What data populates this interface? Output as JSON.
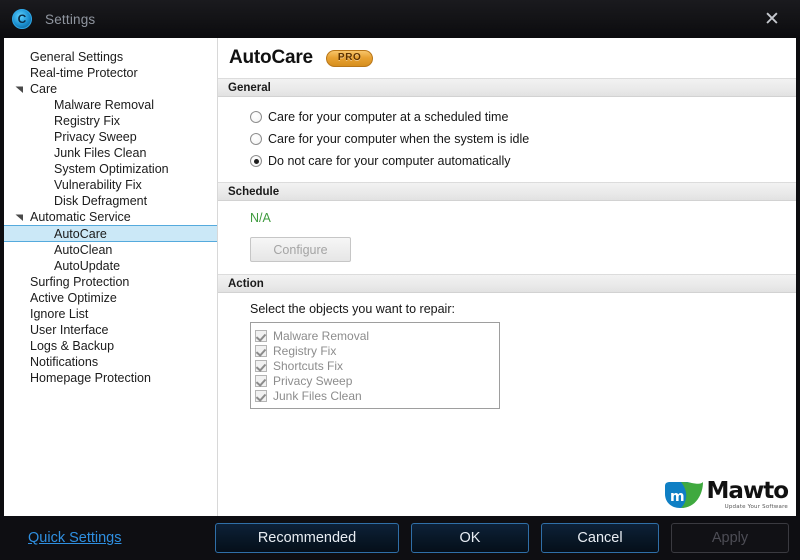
{
  "window": {
    "title": "Settings",
    "logo_icon": "copyright-circle-icon",
    "close_icon": "close-icon"
  },
  "sidebar": {
    "items": [
      {
        "label": "General Settings",
        "level": 1,
        "expander": "none",
        "selected": false
      },
      {
        "label": "Real-time Protector",
        "level": 1,
        "expander": "none",
        "selected": false
      },
      {
        "label": "Care",
        "level": 1,
        "expander": "expanded",
        "selected": false
      },
      {
        "label": "Malware Removal",
        "level": 2,
        "expander": "none",
        "selected": false
      },
      {
        "label": "Registry Fix",
        "level": 2,
        "expander": "none",
        "selected": false
      },
      {
        "label": "Privacy Sweep",
        "level": 2,
        "expander": "none",
        "selected": false
      },
      {
        "label": "Junk Files Clean",
        "level": 2,
        "expander": "none",
        "selected": false
      },
      {
        "label": "System Optimization",
        "level": 2,
        "expander": "none",
        "selected": false
      },
      {
        "label": "Vulnerability Fix",
        "level": 2,
        "expander": "none",
        "selected": false
      },
      {
        "label": "Disk Defragment",
        "level": 2,
        "expander": "none",
        "selected": false
      },
      {
        "label": "Automatic Service",
        "level": 1,
        "expander": "expanded",
        "selected": false
      },
      {
        "label": "AutoCare",
        "level": 2,
        "expander": "none",
        "selected": true
      },
      {
        "label": "AutoClean",
        "level": 2,
        "expander": "none",
        "selected": false
      },
      {
        "label": "AutoUpdate",
        "level": 2,
        "expander": "none",
        "selected": false
      },
      {
        "label": "Surfing Protection",
        "level": 1,
        "expander": "none",
        "selected": false
      },
      {
        "label": "Active Optimize",
        "level": 1,
        "expander": "none",
        "selected": false
      },
      {
        "label": "Ignore List",
        "level": 1,
        "expander": "none",
        "selected": false
      },
      {
        "label": "User Interface",
        "level": 1,
        "expander": "none",
        "selected": false
      },
      {
        "label": "Logs & Backup",
        "level": 1,
        "expander": "none",
        "selected": false
      },
      {
        "label": "Notifications",
        "level": 1,
        "expander": "none",
        "selected": false
      },
      {
        "label": "Homepage Protection",
        "level": 1,
        "expander": "none",
        "selected": false
      }
    ]
  },
  "main": {
    "title": "AutoCare",
    "badge": "PRO",
    "general": {
      "section_title": "General",
      "options": [
        {
          "label": "Care for your computer at a scheduled time",
          "selected": false
        },
        {
          "label": "Care for your computer when the system is idle",
          "selected": false
        },
        {
          "label": "Do not care for your computer automatically",
          "selected": true
        }
      ]
    },
    "schedule": {
      "section_title": "Schedule",
      "value": "N/A",
      "value_color": "#3f9b3f",
      "configure_label": "Configure",
      "configure_enabled": false
    },
    "action": {
      "section_title": "Action",
      "instruction": "Select the objects you want to repair:",
      "items": [
        {
          "label": "Malware Removal",
          "checked": true
        },
        {
          "label": "Registry Fix",
          "checked": true
        },
        {
          "label": "Shortcuts Fix",
          "checked": true
        },
        {
          "label": "Privacy Sweep",
          "checked": true
        },
        {
          "label": "Junk Files Clean",
          "checked": true
        }
      ]
    }
  },
  "watermark": {
    "name": "Mawto",
    "tagline": "Update Your Software"
  },
  "footer": {
    "quick_settings": "Quick Settings",
    "recommended": "Recommended",
    "ok": "OK",
    "cancel": "Cancel",
    "apply": "Apply",
    "apply_enabled": false
  },
  "colors": {
    "accent_blue": "#2f8fe0",
    "selection_blue": "#cbe8f7",
    "pro_gold": "#e8a233",
    "status_green": "#3f9b3f"
  }
}
